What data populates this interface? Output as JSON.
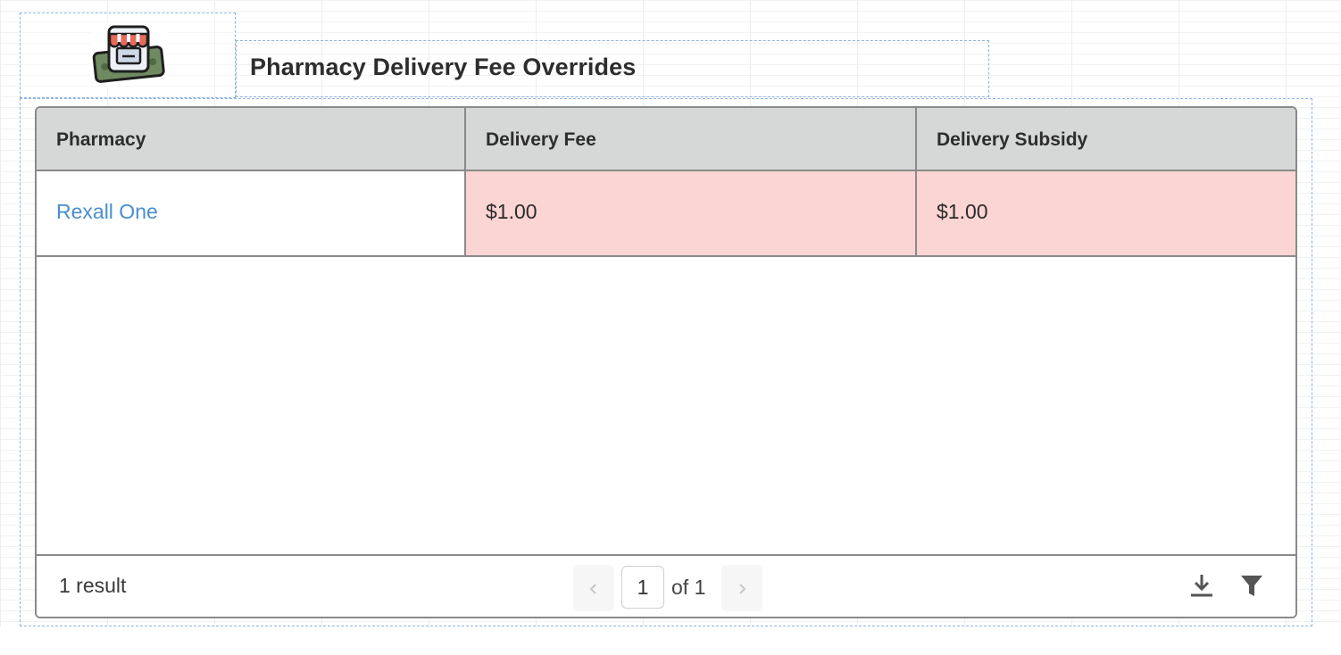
{
  "header": {
    "title": "Pharmacy Delivery Fee Overrides",
    "logo_icon": "storefront-icon"
  },
  "table": {
    "columns": [
      "Pharmacy",
      "Delivery Fee",
      "Delivery Subsidy"
    ],
    "rows": [
      {
        "pharmacy": "Rexall One",
        "delivery_fee": "$1.00",
        "delivery_subsidy": "$1.00"
      }
    ],
    "highlight_color": "#fbd5d3",
    "link_color": "#4a8ed0"
  },
  "footer": {
    "result_count": "1 result",
    "page_current": "1",
    "page_of": "of 1",
    "prev_icon": "chevron-left-icon",
    "next_icon": "chevron-right-icon",
    "download_icon": "download-icon",
    "filter_icon": "filter-icon"
  }
}
